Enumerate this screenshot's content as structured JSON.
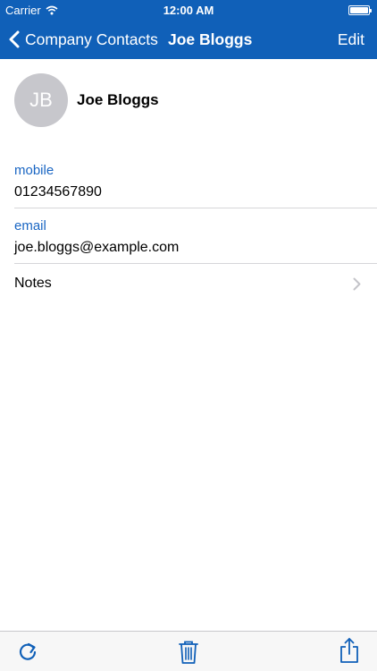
{
  "status_bar": {
    "carrier": "Carrier",
    "time": "12:00 AM"
  },
  "nav": {
    "back_label": "Company Contacts",
    "title": "Joe Bloggs",
    "edit_label": "Edit"
  },
  "contact": {
    "initials": "JB",
    "name": "Joe Bloggs"
  },
  "fields": [
    {
      "label": "mobile",
      "value": "01234567890"
    },
    {
      "label": "email",
      "value": "joe.bloggs@example.com"
    }
  ],
  "notes_label": "Notes",
  "toolbar": {
    "icons": [
      "refresh-icon",
      "trash-icon",
      "share-icon"
    ]
  },
  "colors": {
    "nav_bg": "#1060b8",
    "field_label": "#1a66c3",
    "toolbar_icon": "#1060b8"
  }
}
